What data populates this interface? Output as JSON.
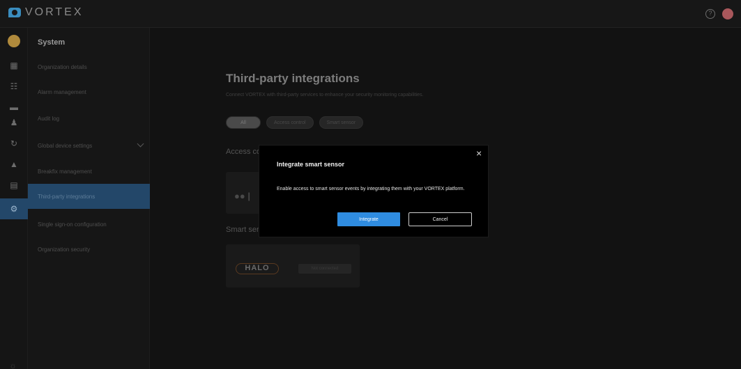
{
  "app": {
    "brand": "VORTEX"
  },
  "header": {
    "help_icon": "help-circle-icon"
  },
  "rail": {
    "icons": [
      "dashboard-icon",
      "devices-icon",
      "video-icon",
      "person-icon",
      "history-icon",
      "alerts-icon",
      "archive-icon",
      "gear-icon"
    ],
    "active": "gear-icon"
  },
  "sidebar": {
    "title": "System",
    "items": [
      {
        "label": "Organization details"
      },
      {
        "label": "Alarm management"
      },
      {
        "label": "Audit log"
      },
      {
        "label": "Global device settings"
      },
      {
        "label": "Breakfix management"
      },
      {
        "label": "Third-party integrations"
      },
      {
        "label": "Single sign-on configuration"
      },
      {
        "label": "Organization security"
      }
    ],
    "active_item": "Third-party integrations"
  },
  "main": {
    "title": "Third-party integrations",
    "subtitle": "Connect VORTEX with third-party services to enhance your security monitoring capabilities.",
    "filters": [
      "All",
      "Access control",
      "Smart sensor"
    ],
    "active_filter": "All",
    "sections": [
      {
        "label": "Access co"
      },
      {
        "label": "Smart ser"
      }
    ],
    "halo_card": {
      "logo": "HALO",
      "status": "Not connected"
    }
  },
  "modal": {
    "title": "Integrate smart sensor",
    "body": "Enable access to smart sensor events by integrating them with your VORTEX platform.",
    "primary_label": "Integrate",
    "secondary_label": "Cancel",
    "close_glyph": "×",
    "accent_color": "#2f8ce0"
  }
}
